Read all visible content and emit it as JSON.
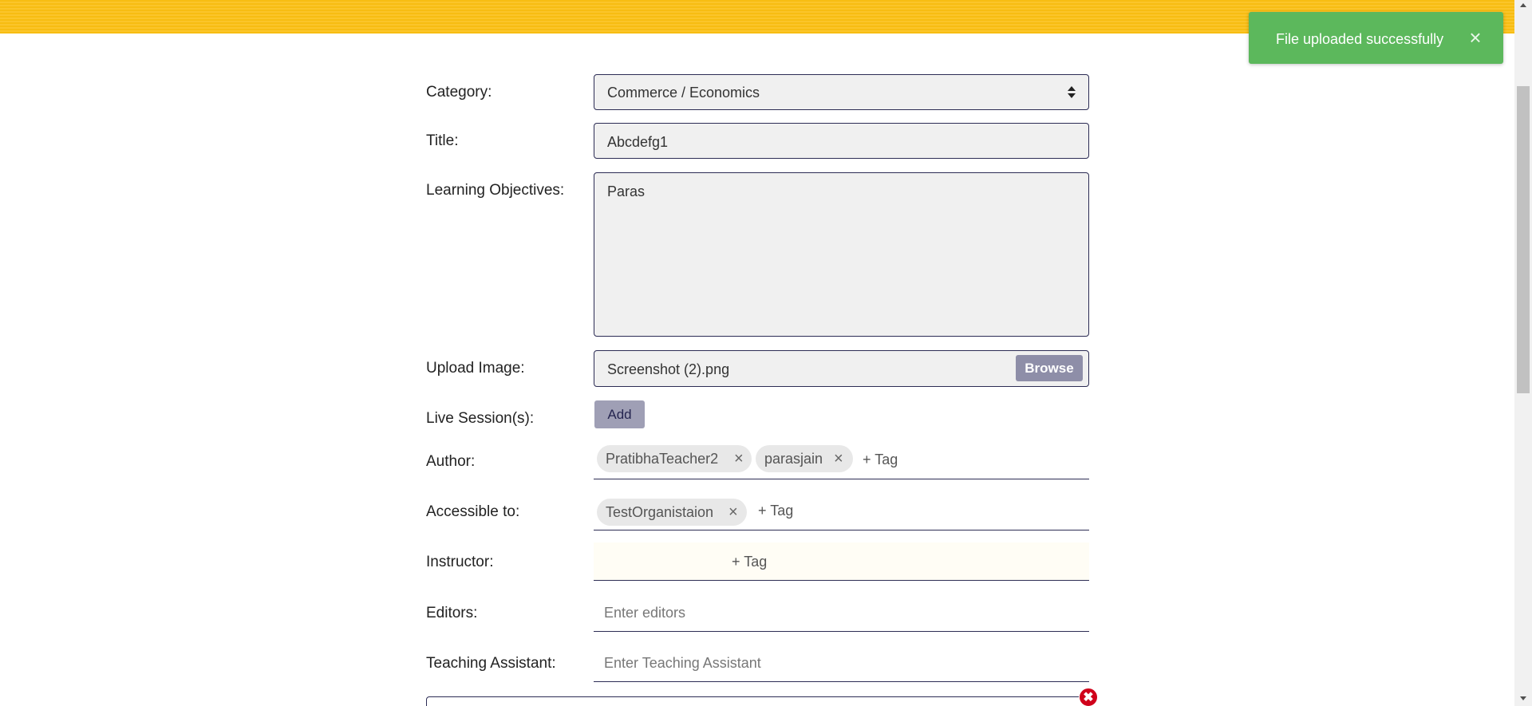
{
  "toast": {
    "message": "File uploaded successfully",
    "close_glyph": "×"
  },
  "form": {
    "category": {
      "label": "Category:",
      "value": "Commerce / Economics"
    },
    "title": {
      "label": "Title:",
      "value": "Abcdefg1"
    },
    "learning_objectives": {
      "label": "Learning Objectives:",
      "value": "Paras"
    },
    "upload_image": {
      "label": "Upload Image:",
      "value": "Screenshot (2).png",
      "browse_label": "Browse"
    },
    "live_sessions": {
      "label": "Live Session(s):",
      "add_label": "Add"
    },
    "author": {
      "label": "Author:",
      "tags": [
        "PratibhaTeacher2",
        "parasjain"
      ],
      "add_tag_label": "+ Tag"
    },
    "accessible_to": {
      "label": "Accessible to:",
      "tags": [
        "TestOrganistaion"
      ],
      "add_tag_label": "+ Tag"
    },
    "instructor": {
      "label": "Instructor:",
      "add_tag_label": "+ Tag"
    },
    "editors": {
      "label": "Editors:",
      "placeholder": "Enter editors"
    },
    "teaching_assistant": {
      "label": "Teaching Assistant:",
      "placeholder": "Enter Teaching Assistant"
    }
  },
  "icons": {
    "chip_remove": "×",
    "remove_section": "✖"
  },
  "colors": {
    "banner": "#f7bd12",
    "toast": "#5cb85c",
    "field_border": "#2c2c54",
    "browse": "#8e8ea8",
    "remove": "#d0021b"
  }
}
